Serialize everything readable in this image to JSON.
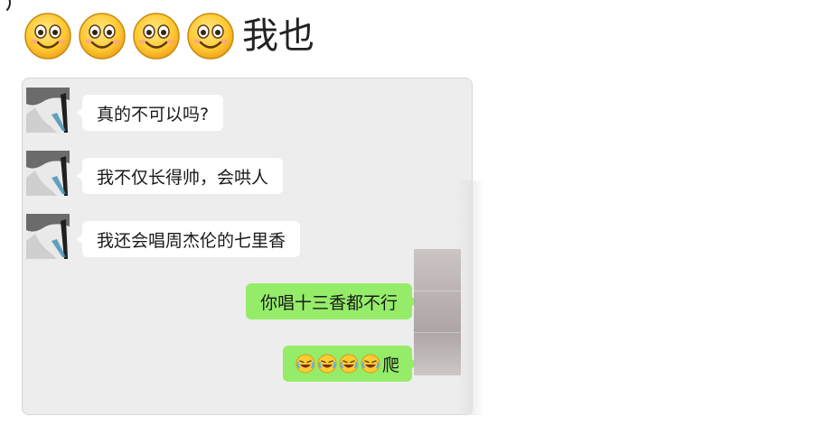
{
  "caption": {
    "emoji": "smile-emoji",
    "emoji_count": 4,
    "text": "我也"
  },
  "chat": {
    "messages": [
      {
        "side": "left",
        "text": "真的不可以吗?"
      },
      {
        "side": "left",
        "text": "我不仅长得帅，会哄人"
      },
      {
        "side": "left",
        "text": "我还会唱周杰伦的七里香"
      },
      {
        "side": "right",
        "text": "你唱十三香都不行"
      },
      {
        "side": "right",
        "emoji": "laugh-cry-emoji",
        "emoji_count": 4,
        "text": "爬"
      }
    ]
  },
  "colors": {
    "chat_background": "#ededed",
    "incoming_bubble": "#ffffff",
    "outgoing_bubble": "#95ec69"
  }
}
